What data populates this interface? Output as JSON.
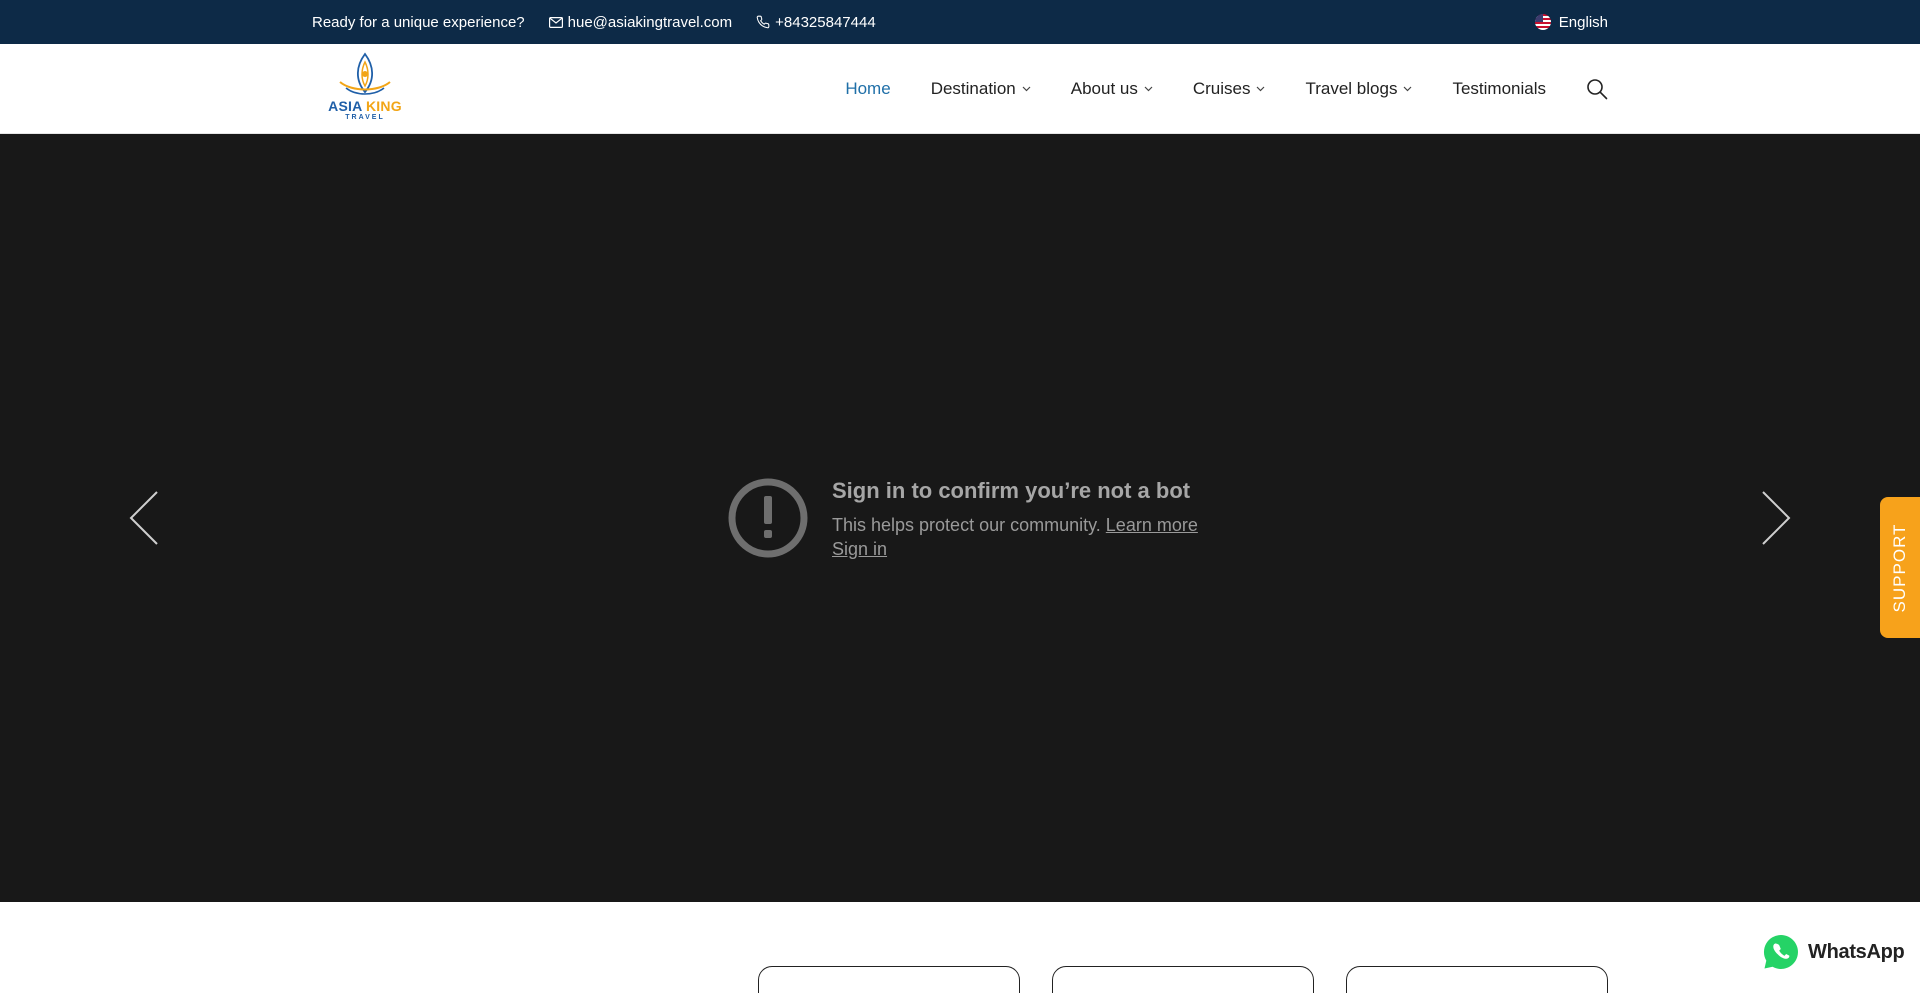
{
  "topbar": {
    "tagline": "Ready for a unique experience?",
    "email": "hue@asiakingtravel.com",
    "phone": "+84325847444",
    "language": "English"
  },
  "logo": {
    "brand_left": "ASIA",
    "brand_right": "KING",
    "sub": "TRAVEL"
  },
  "nav": {
    "items": [
      {
        "label": "Home"
      },
      {
        "label": "Destination"
      },
      {
        "label": "About us"
      },
      {
        "label": "Cruises"
      },
      {
        "label": "Travel blogs"
      },
      {
        "label": "Testimonials"
      }
    ]
  },
  "video_error": {
    "title": "Sign in to confirm you’re not a bot",
    "description": "This helps protect our community.",
    "learn_more": "Learn more",
    "sign_in": "Sign in"
  },
  "support": {
    "label": "SUPPORT"
  },
  "whatsapp": {
    "label": "WhatsApp"
  },
  "colors": {
    "topbar_bg": "#0d2a47",
    "nav_active": "#1f6fa8",
    "hero_bg": "#181818",
    "support_bg": "#f7a21b",
    "whatsapp_green": "#25d366"
  },
  "icons": [
    "mail-icon",
    "phone-icon",
    "us-flag-icon",
    "chevron-down-icon",
    "search-icon",
    "chevron-left-icon",
    "chevron-right-icon",
    "alert-circle-icon",
    "whatsapp-icon"
  ]
}
